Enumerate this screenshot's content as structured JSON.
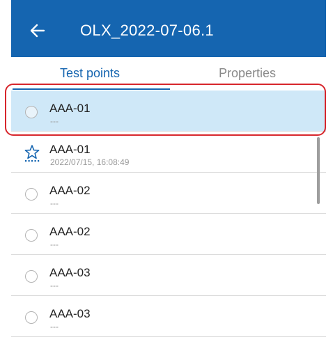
{
  "appbar": {
    "back_icon": "arrow-left-icon",
    "title": "OLX_2022-07-06.1"
  },
  "tabs": [
    {
      "label": "Test points",
      "active": true
    },
    {
      "label": "Properties",
      "active": false
    }
  ],
  "list": {
    "items": [
      {
        "name": "AAA-01",
        "sub": "---",
        "icon": "radio-icon",
        "selected": true
      },
      {
        "name": "AAA-01",
        "sub": "2022/07/15, 16:08:49",
        "icon": "star-icon",
        "selected": false
      },
      {
        "name": "AAA-02",
        "sub": "---",
        "icon": "radio-icon",
        "selected": false
      },
      {
        "name": "AAA-02",
        "sub": "---",
        "icon": "radio-icon",
        "selected": false
      },
      {
        "name": "AAA-03",
        "sub": "---",
        "icon": "radio-icon",
        "selected": false
      },
      {
        "name": "AAA-03",
        "sub": "---",
        "icon": "radio-icon",
        "selected": false
      }
    ]
  },
  "colors": {
    "appbar": "#1565b0",
    "selected_row": "#cfe8f8",
    "highlight_frame": "#d7262c",
    "inactive_tab": "#8a8a8a"
  }
}
